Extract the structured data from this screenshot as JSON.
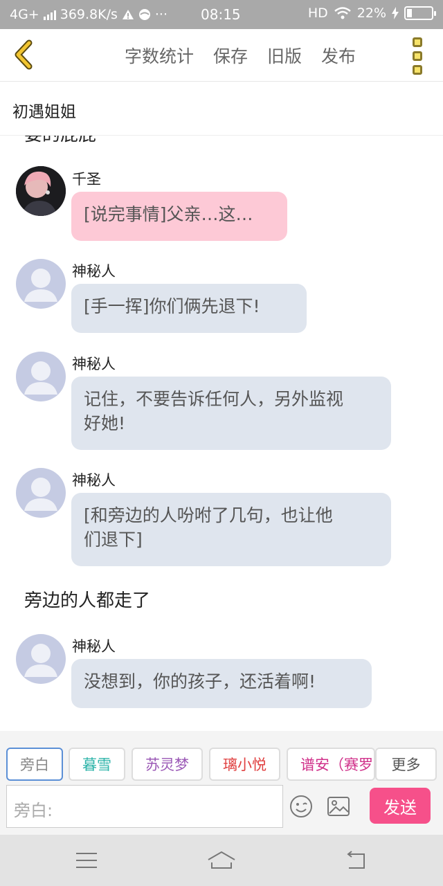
{
  "status_bar": {
    "network": "4G+",
    "speed": "369.8K/s",
    "dots": "···",
    "time": "08:15",
    "hd": "HD",
    "battery_percent": "22%",
    "battery_level": 0.22
  },
  "nav": {
    "word_count": "字数统计",
    "save": "保存",
    "old_version": "旧版",
    "publish": "发布"
  },
  "chapter_title": "初遇姐姐",
  "chat": {
    "cut_text": "要的屁屁",
    "messages": [
      {
        "sender": "千圣",
        "text": "[说完事情]父亲…这…"
      },
      {
        "sender": "神秘人",
        "text": "[手一挥]你们俩先退下!"
      },
      {
        "sender": "神秘人",
        "text_line1": "记住，不要告诉任何人，另外监视",
        "text_line2": "好她!"
      },
      {
        "sender": "神秘人",
        "text_line1": "[和旁边的人吩咐了几句，也让他",
        "text_line2": "们退下]"
      },
      {
        "sender": "神秘人",
        "text": "没想到，你的孩子，还活着啊!"
      }
    ],
    "narration": "旁边的人都走了"
  },
  "composer": {
    "chips": [
      {
        "label": "旁白",
        "color": "#888888"
      },
      {
        "label": "暮雪",
        "color": "#2bb3a8"
      },
      {
        "label": "苏灵梦",
        "color": "#9b59b6"
      },
      {
        "label": "璃小悦",
        "color": "#e04040"
      },
      {
        "label": "谱安（赛罗",
        "color": "#d0308a"
      }
    ],
    "more": "更多",
    "placeholder": "旁白:",
    "send": "发送"
  },
  "colors": {
    "status_bar": "#a9a9a9",
    "bubble_default": "#dfe5ee",
    "bubble_pink": "#fdc9d6",
    "send_button": "#f6508a",
    "back_icon": "#f2c531"
  }
}
